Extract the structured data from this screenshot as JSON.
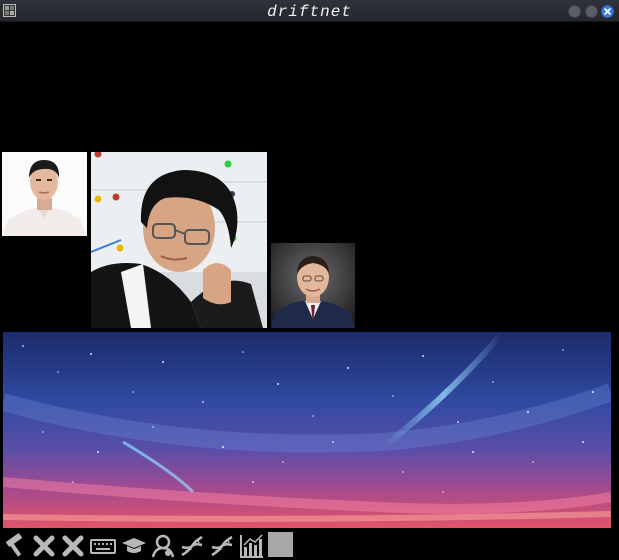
{
  "window": {
    "title": "driftnet"
  },
  "captures": [
    {
      "id": "portrait-young-man",
      "kind": "photo"
    },
    {
      "id": "portrait-man-glasses-whiteboard",
      "kind": "photo"
    },
    {
      "id": "portrait-older-man",
      "kind": "photo"
    },
    {
      "id": "starfield-banner",
      "kind": "photo"
    }
  ],
  "toolbar": {
    "tools": [
      "hammer-icon",
      "close-x-icon",
      "close-x-icon",
      "keyboard-icon",
      "graduation-cap-icon",
      "user-icon",
      "dna-icon",
      "dna-icon",
      "chart-icon"
    ],
    "swatch_color": "#a8a8a8"
  },
  "colors": {
    "titlebar": "#2a2c33",
    "close_button": "#3b7de8",
    "background": "#000000"
  }
}
